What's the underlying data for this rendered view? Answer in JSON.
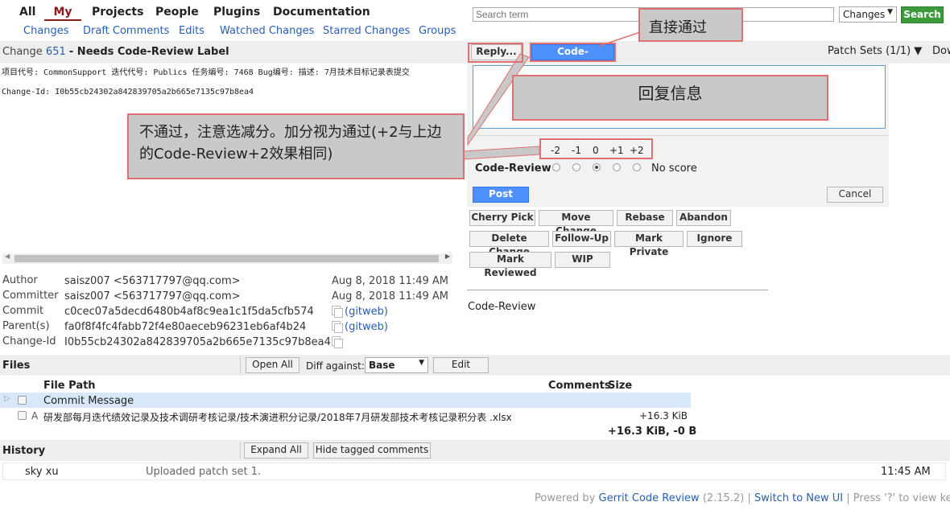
{
  "topnav": {
    "all": "All",
    "my": "My",
    "projects": "Projects",
    "people": "People",
    "plugins": "Plugins",
    "documentation": "Documentation"
  },
  "subnav": {
    "changes": "Changes",
    "draft_comments": "Draft Comments",
    "edits": "Edits",
    "watched": "Watched Changes",
    "starred": "Starred Changes",
    "groups": "Groups"
  },
  "search": {
    "placeholder": "Search term",
    "scope": "Changes",
    "button": "Search"
  },
  "change": {
    "prefix": "Change",
    "number": "651",
    "status": "- Needs Code-Review Label",
    "description": "项目代号: CommonSupport 迭代代号: Publics 任务编号: 7468 Bug编号: 描述: 7月技术目标记录表提交",
    "change_id_line": "Change-Id: I0b55cb24302a842839705a2b665e7135c97b8ea4"
  },
  "actions": {
    "reply": "Reply...",
    "code_review_plus2": "Code-Review+2",
    "patch_sets": "Patch Sets (1/1)",
    "download": "Dow"
  },
  "reply_panel": {
    "scores": [
      "-2",
      "-1",
      "0",
      "+1",
      "+2"
    ],
    "label_name": "Code-Review",
    "no_score": "No score",
    "post": "Post",
    "cancel": "Cancel",
    "selected_index": 2
  },
  "action_buttons": {
    "cherry_pick": "Cherry Pick",
    "move_change": "Move Change",
    "rebase": "Rebase",
    "abandon": "Abandon",
    "delete_change": "Delete Change",
    "follow_up": "Follow-Up",
    "mark_private": "Mark Private",
    "ignore": "Ignore",
    "mark_reviewed": "Mark Reviewed",
    "wip": "WIP"
  },
  "labels_section": {
    "code_review": "Code-Review"
  },
  "annotations": {
    "direct_pass": "直接通过",
    "reply_info": "回复信息",
    "fail_note": "不通过，注意选减分。加分视为通过(+2与上边的Code-Review+2效果相同)"
  },
  "meta": {
    "author_label": "Author",
    "author": "saisz007 <563717797@qq.com>",
    "author_date": "Aug 8, 2018 11:49 AM",
    "committer_label": "Committer",
    "committer": "saisz007 <563717797@qq.com>",
    "committer_date": "Aug 8, 2018 11:49 AM",
    "commit_label": "Commit",
    "commit": "c0cec07a5decd6480b4af8c9ea1c1f5da5cfb574",
    "gitweb": "(gitweb)",
    "parent_label": "Parent(s)",
    "parent": "fa0f8f4fc4fabb72f4e80aeceb96231eb6af4b24",
    "changeid_label": "Change-Id",
    "changeid": "I0b55cb24302a842839705a2b665e7135c97b8ea4"
  },
  "files": {
    "title": "Files",
    "open_all": "Open All",
    "diff_against": "Diff against:",
    "base": "Base",
    "edit": "Edit",
    "col_path": "File Path",
    "col_comments": "Comments",
    "col_size": "Size",
    "rows": [
      {
        "status": "",
        "path": "Commit Message",
        "size": ""
      },
      {
        "status": "A",
        "path": "研发部每月迭代绩效记录及技术调研考核记录/技术演进积分记录/2018年7月研发部技术考核记录积分表 .xlsx",
        "size": "+16.3 KiB"
      }
    ],
    "total": "+16.3 KiB, -0 B"
  },
  "history": {
    "title": "History",
    "expand_all": "Expand All",
    "hide_tagged": "Hide tagged comments",
    "entries": [
      {
        "author": "sky xu",
        "message": "Uploaded patch set 1.",
        "time": "11:45 AM"
      }
    ]
  },
  "footer": {
    "powered_by": "Powered by",
    "gerrit": "Gerrit Code Review",
    "version": "(2.15.2)",
    "sep1": "|",
    "switch_ui": "Switch to New UI",
    "sep2": "|",
    "help": "Press '?' to view keybo"
  }
}
